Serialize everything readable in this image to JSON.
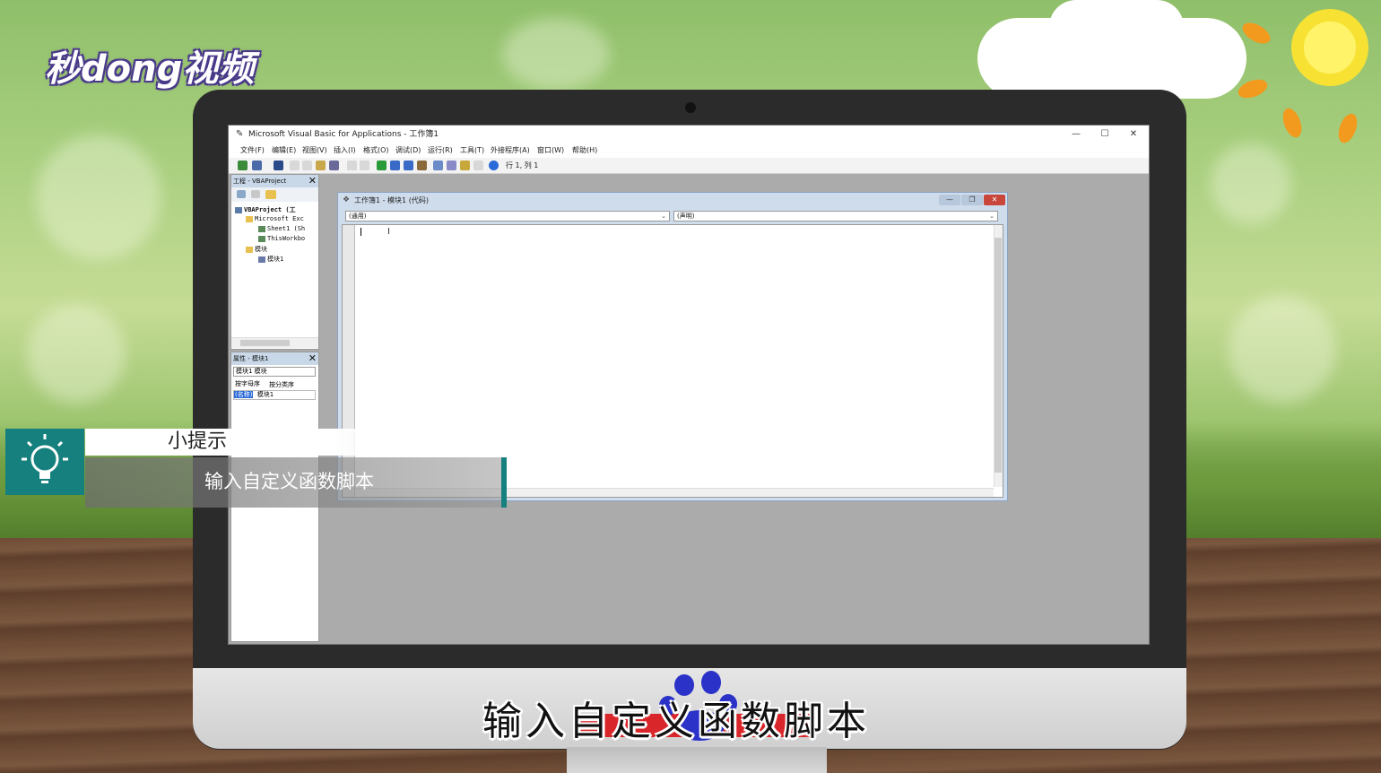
{
  "logo": {
    "text": "秒dong视频"
  },
  "window": {
    "title": "Microsoft Visual Basic for Applications - 工作簿1",
    "controls": {
      "minimize": "—",
      "maximize": "☐",
      "close": "✕"
    }
  },
  "menu": [
    {
      "label": "文件(F)"
    },
    {
      "label": "编辑(E)"
    },
    {
      "label": "视图(V)"
    },
    {
      "label": "插入(I)"
    },
    {
      "label": "格式(O)"
    },
    {
      "label": "调试(D)"
    },
    {
      "label": "运行(R)"
    },
    {
      "label": "工具(T)"
    },
    {
      "label": "外接程序(A)"
    },
    {
      "label": "窗口(W)"
    },
    {
      "label": "帮助(H)"
    }
  ],
  "toolbar": {
    "cursor_position": "行 1, 列 1"
  },
  "project_panel": {
    "title": "工程 - VBAProject",
    "close": "✕",
    "tree": [
      {
        "label": "VBAProject (工"
      },
      {
        "label": "Microsoft Exc"
      },
      {
        "label": "Sheet1 (Sh"
      },
      {
        "label": "ThisWorkbo"
      },
      {
        "label": "模块"
      },
      {
        "label": "模块1"
      }
    ]
  },
  "properties_panel": {
    "title": "属性 - 模块1",
    "close": "✕",
    "object_select": "模块1 模块",
    "tabs": [
      {
        "label": "按字母序"
      },
      {
        "label": "按分类序"
      }
    ],
    "row": {
      "name": "(名称)",
      "value": "模块1"
    }
  },
  "code_window": {
    "title": "工作簿1 - 模块1 (代码)",
    "object_combo": "(通用)",
    "procedure_combo": "(声明)"
  },
  "tip": {
    "heading": "小提示",
    "body": "输入自定义函数脚本"
  },
  "subtitle": "输入自定义函数脚本",
  "colors": {
    "accent": "#15807d",
    "panel_header": "#c8d8e8",
    "code_frame": "#cfdcec"
  }
}
